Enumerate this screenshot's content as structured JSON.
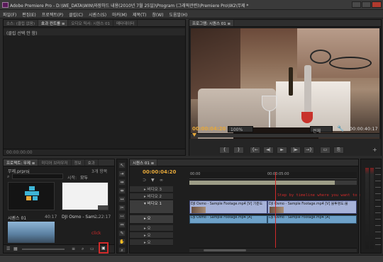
{
  "window": {
    "title": "Adobe Premiere Pro - D:\\WE_DATA\\WIN\\와장하드 내용(2010년 7월 25일)\\Program (그래픽관련)\\Premiere Pro\\W2\\무제 *"
  },
  "menu": [
    "파일(F)",
    "편집(E)",
    "프로젝트(P)",
    "클립(C)",
    "시퀀스(S)",
    "마커(M)",
    "제목(T)",
    "창(W)",
    "도움말(H)"
  ],
  "source_panel": {
    "tabs": [
      "소스: (클립 없음)",
      "효과 컨트롤 ≡",
      "오디오 믹서: 시퀀스 01",
      "메타데이터"
    ],
    "message": "(클립 선택 안 함)",
    "timecode": "00:00:00:00"
  },
  "program_monitor": {
    "tab": "프로그램: 시퀀스 01 ≡",
    "timecode_left": "00:00:04:20",
    "zoom": "100%",
    "resolution": "전체",
    "timecode_right": "00:00:40:17",
    "controls": [
      "{",
      "}",
      "{←",
      "◄|",
      "►",
      "|►",
      "→}",
      "▭",
      "⎘"
    ]
  },
  "project_panel": {
    "tabs": [
      "프로젝트: 무제 ≡",
      "미디어 브라우저",
      "정보",
      "효과"
    ],
    "project_file": "무제.prproj",
    "item_count": "3개 항목",
    "search_label": "시작:",
    "search_value": "모두",
    "items": [
      {
        "name": "시퀀스 01",
        "duration": "40:17"
      },
      {
        "name": "DJI Osmo - Sam...",
        "duration": "2:22:17"
      },
      {
        "name": "",
        "duration": ""
      }
    ],
    "click_label": "click"
  },
  "timeline": {
    "tab": "시퀀스 01 ≡",
    "timecode": "00:00:04:20",
    "ruler_labels": [
      "00:00",
      "00:00:05:00"
    ],
    "annotation": "Step by timeline where you want to stop",
    "video_tracks": [
      "▸ 비디오 3",
      "▸ 비디오 2",
      "▾ 비디오 1"
    ],
    "audio_tracks": [
      "▸ 오",
      "▸ 오",
      "▸ 오",
      "▸ 오"
    ],
    "video_clip_a": "DJI Osmo - Sample Footage.mp4 [V] 기준도",
    "video_clip_b": "DJI Osmo - Sample Footage.mp4 [V] 불투명도:불",
    "audio_clip_a": "DJI Osmo - Sample Footage.mp4 [A]",
    "audio_clip_b": "DJI Osmo - Sample Footage.mp4 [A]"
  },
  "colors": {
    "timecode": "#e6a83a",
    "annotation": "#d12a2a",
    "playhead": "#d12a2a"
  }
}
